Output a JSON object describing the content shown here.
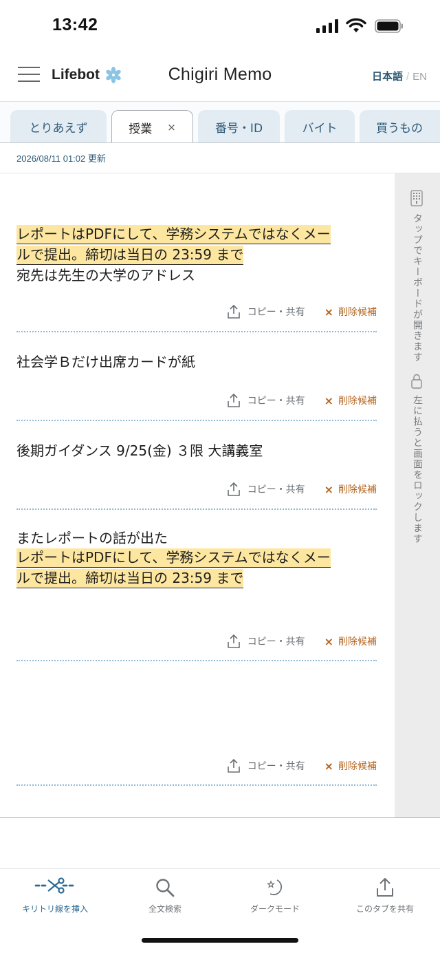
{
  "status_bar": {
    "time": "13:42"
  },
  "header": {
    "brand": "Lifebot",
    "title": "Chigiri Memo",
    "lang_ja": "日本語",
    "lang_sep": "/",
    "lang_en": "EN"
  },
  "tabs": [
    {
      "label": "とりあえず",
      "active": false
    },
    {
      "label": "授業",
      "active": true,
      "close": "×"
    },
    {
      "label": "番号・ID",
      "active": false
    },
    {
      "label": "バイト",
      "active": false
    },
    {
      "label": "買うもの",
      "active": false
    }
  ],
  "updated": "2026/08/11 01:02 更新",
  "memos": [
    {
      "highlight_lines": [
        "レポートはPDFにして、学務システムではなくメー",
        "ルで提出。締切は当日の 23:59 まで"
      ],
      "lines": [
        "宛先は先生の大学のアドレス"
      ]
    },
    {
      "lines": [
        "社会学Ｂだけ出席カードが紙"
      ]
    },
    {
      "lines": [
        "後期ガイダンス 9/25(金) ３限 大講義室"
      ]
    },
    {
      "lines_before": [
        "またレポートの話が出た"
      ],
      "highlight_lines": [
        "レポートはPDFにして、学務システムではなくメー",
        "ルで提出。締切は当日の 23:59 まで"
      ]
    },
    {
      "lines": []
    }
  ],
  "memo_actions": {
    "copy": "コピー・共有",
    "delete_icon": "×",
    "delete": "削除候補"
  },
  "side_panel": {
    "keyboard_hint": "タップでキーボードが開きます",
    "lock_hint": "左に払うと画面をロックします"
  },
  "toolbar": {
    "insert": "キリトリ線を挿入",
    "search": "全文検索",
    "dark": "ダークモード",
    "share": "このタブを共有"
  },
  "colors": {
    "accent": "#2d6a93",
    "highlight": "#fde7a0",
    "delete": "#b4651f",
    "divider": "#8fbad8",
    "tab_bg": "#e3ecf3"
  }
}
